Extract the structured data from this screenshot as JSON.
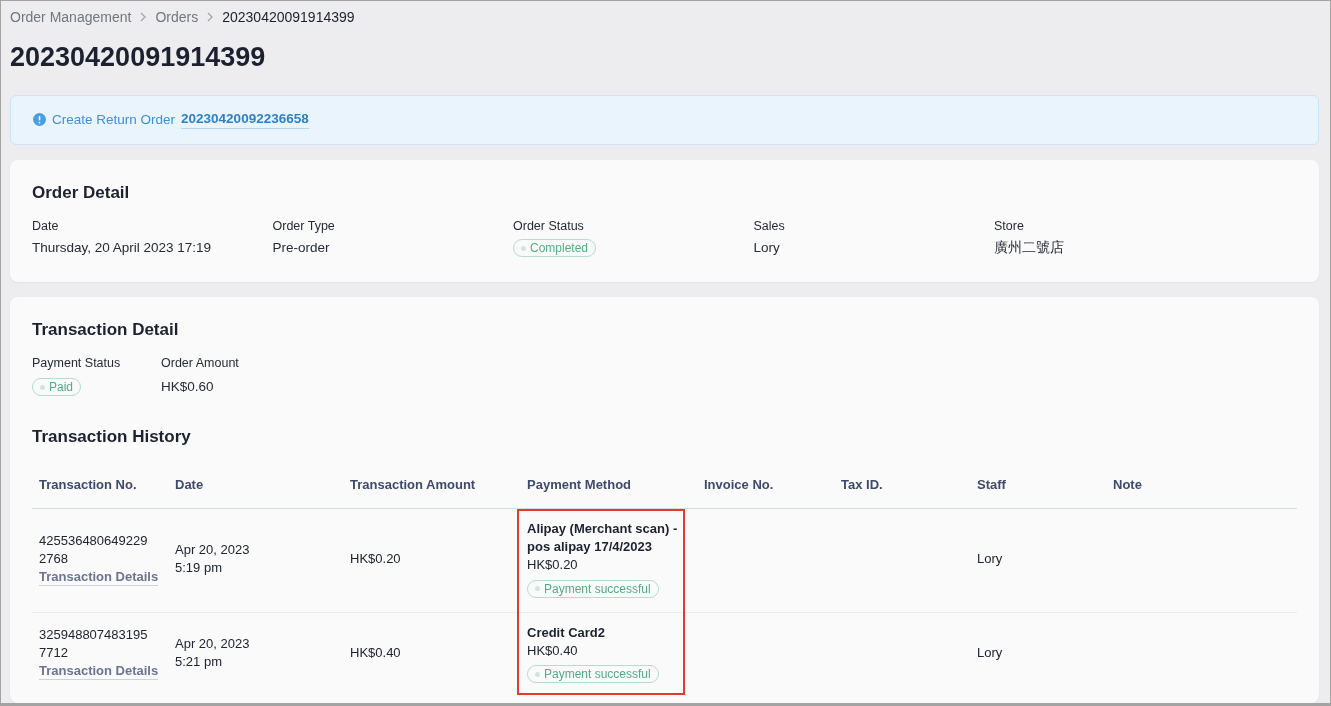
{
  "breadcrumb": [
    {
      "label": "Order Management",
      "current": false
    },
    {
      "label": "Orders",
      "current": false
    },
    {
      "label": "20230420091914399",
      "current": true
    }
  ],
  "title": "20230420091914399",
  "alert": {
    "text": "Create Return Order",
    "link": "20230420092236658"
  },
  "order_detail": {
    "title": "Order Detail",
    "fields": [
      {
        "label": "Date",
        "value": "Thursday, 20 April 2023 17:19",
        "kind": "text"
      },
      {
        "label": "Order Type",
        "value": "Pre-order",
        "kind": "text"
      },
      {
        "label": "Order Status",
        "value": "Completed",
        "kind": "badge"
      },
      {
        "label": "Sales",
        "value": "Lory",
        "kind": "text"
      },
      {
        "label": "Store",
        "value": "廣州二號店",
        "kind": "text"
      }
    ]
  },
  "transaction_detail": {
    "title": "Transaction Detail",
    "fields": [
      {
        "label": "Payment Status",
        "value": "Paid",
        "kind": "badge"
      },
      {
        "label": "Order Amount",
        "value": "HK$0.60",
        "kind": "text"
      }
    ]
  },
  "transaction_history": {
    "title": "Transaction History",
    "columns": [
      {
        "label": "Transaction No.",
        "highlighted": false
      },
      {
        "label": "Date",
        "highlighted": false
      },
      {
        "label": "Transaction Amount",
        "highlighted": false
      },
      {
        "label": "Payment Method",
        "highlighted": true
      },
      {
        "label": "Invoice No.",
        "highlighted": false
      },
      {
        "label": "Tax ID.",
        "highlighted": false
      },
      {
        "label": "Staff",
        "highlighted": false
      },
      {
        "label": "Note",
        "highlighted": false
      }
    ],
    "rows": [
      {
        "transaction_no": "4255364806492292768",
        "details_link": "Transaction Details",
        "date": "Apr 20, 2023",
        "time": "5:19 pm",
        "amount": "HK$0.20",
        "payment": {
          "name": "Alipay (Merchant scan) - pos alipay 17/4/2023",
          "amount": "HK$0.20",
          "status": "Payment successful"
        },
        "staff": "Lory"
      },
      {
        "transaction_no": "3259488074831957712",
        "details_link": "Transaction Details",
        "date": "Apr 20, 2023",
        "time": "5:21 pm",
        "amount": "HK$0.40",
        "payment": {
          "name": "Credit Card2",
          "amount": "HK$0.40",
          "status": "Payment successful"
        },
        "staff": "Lory"
      }
    ]
  }
}
